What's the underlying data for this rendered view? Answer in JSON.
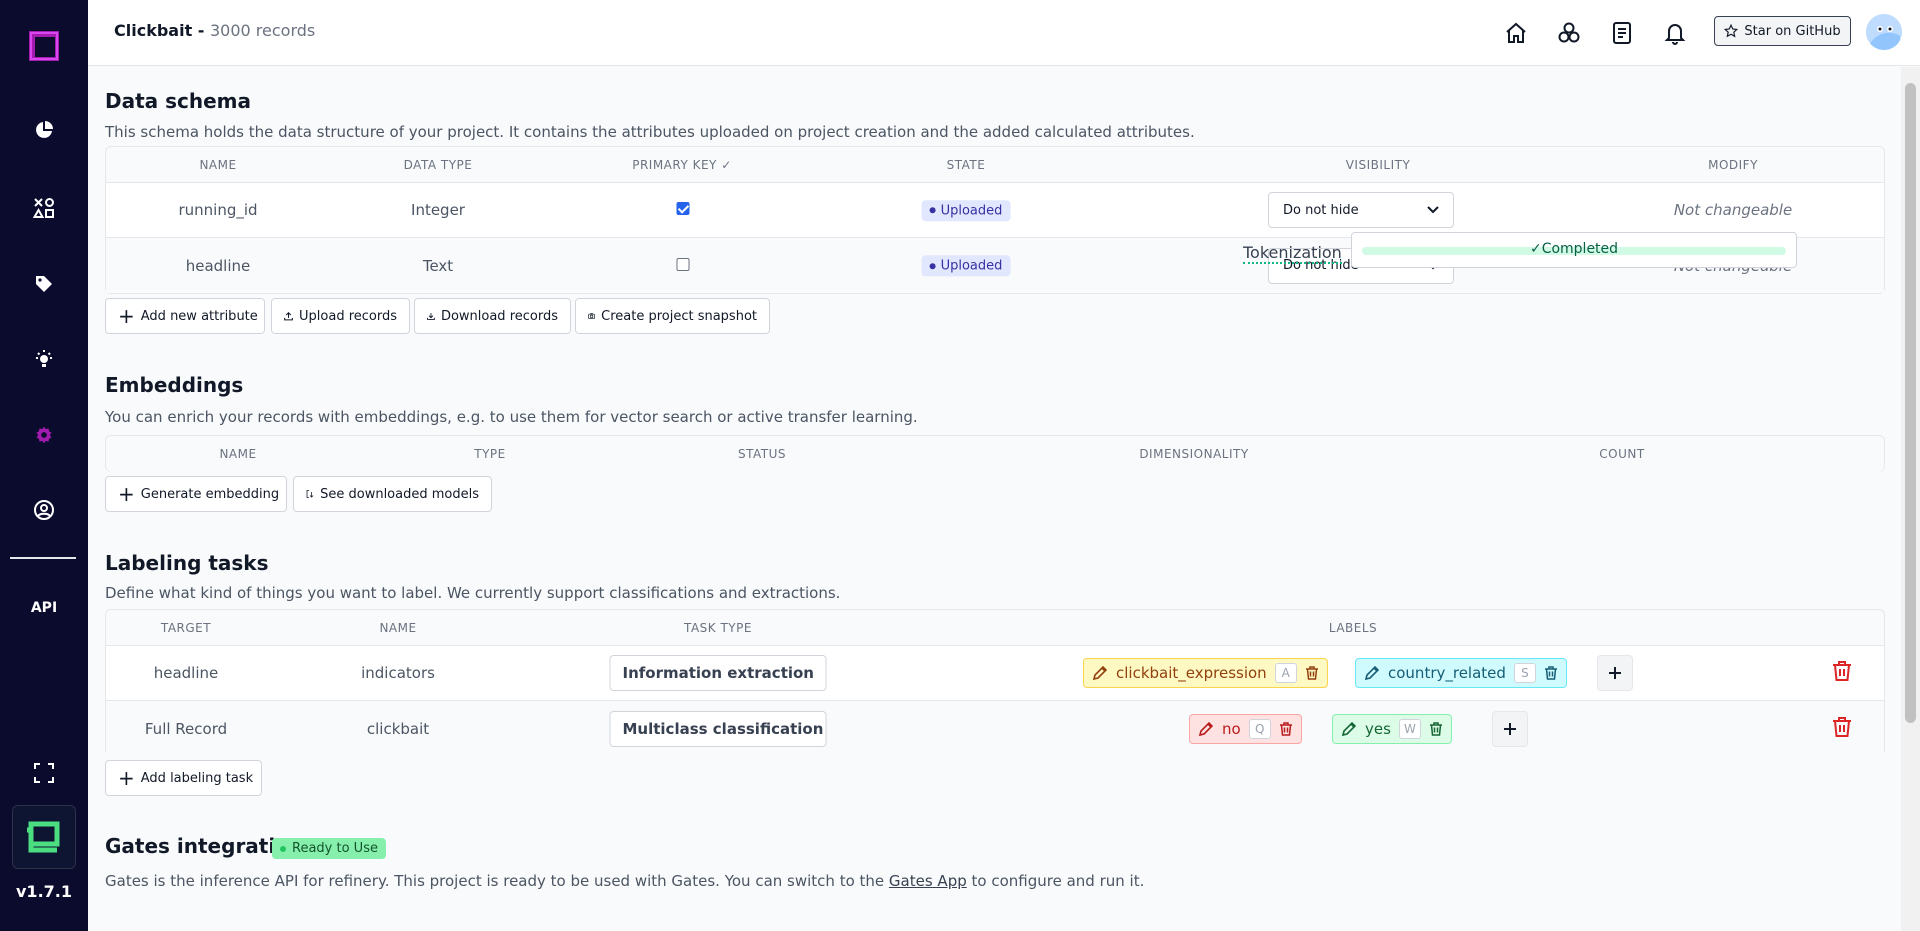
{
  "app": {
    "version": "v1.7.1",
    "api_label": "API"
  },
  "header": {
    "project_name": "Clickbait",
    "record_count": "3000 records",
    "github_label": "Star on GitHub"
  },
  "data_schema": {
    "title": "Data schema",
    "description": "This schema holds the data structure of your project. It contains the attributes uploaded on project creation and the added calculated attributes.",
    "columns": [
      "NAME",
      "DATA TYPE",
      "PRIMARY KEY",
      "STATE",
      "VISIBILITY",
      "MODIFY"
    ],
    "rows": [
      {
        "name": "running_id",
        "data_type": "Integer",
        "primary_key": true,
        "state": "Uploaded",
        "visibility": "Do not hide",
        "modify": "Not changeable"
      },
      {
        "name": "headline",
        "data_type": "Text",
        "primary_key": false,
        "state": "Uploaded",
        "visibility": "Do not hide",
        "modify": "Not changeable"
      }
    ],
    "buttons": {
      "add_attribute": "Add new attribute",
      "upload": "Upload records",
      "download": "Download records",
      "snapshot": "Create project snapshot"
    },
    "tokenization_label": "Tokenization",
    "tokenization_status": "Completed",
    "tokenization_progress": 1.0
  },
  "embeddings": {
    "title": "Embeddings",
    "description": "You can enrich your records with embeddings, e.g. to use them for vector search or active transfer learning.",
    "columns": [
      "NAME",
      "TYPE",
      "STATUS",
      "DIMENSIONALITY",
      "COUNT"
    ],
    "buttons": {
      "generate": "Generate embedding",
      "models": "See downloaded models"
    }
  },
  "labeling_tasks": {
    "title": "Labeling tasks",
    "description": "Define what kind of things you want to label. We currently support classifications and extractions.",
    "columns": [
      "TARGET",
      "NAME",
      "TASK TYPE",
      "LABELS"
    ],
    "rows": [
      {
        "target": "headline",
        "name": "indicators",
        "task_type": "Information extraction",
        "labels": [
          {
            "name": "clickbait_expression",
            "key": "A",
            "color": "yellow"
          },
          {
            "name": "country_related",
            "key": "S",
            "color": "cyan"
          }
        ]
      },
      {
        "target": "Full Record",
        "name": "clickbait",
        "task_type": "Multiclass classification",
        "labels": [
          {
            "name": "no",
            "key": "Q",
            "color": "red"
          },
          {
            "name": "yes",
            "key": "W",
            "color": "green"
          }
        ]
      }
    ],
    "add_button": "Add labeling task"
  },
  "gates": {
    "title": "Gates integration",
    "badge": "Ready to Use",
    "description_before": "Gates is the inference API for refinery. This project is ready to be used with Gates. You can switch to the",
    "link": "Gates App",
    "description_after": "to configure and run it."
  },
  "colors": {
    "sidebar": "#0b0b2e",
    "accent": "#a21caf",
    "delete": "#dc2626"
  }
}
